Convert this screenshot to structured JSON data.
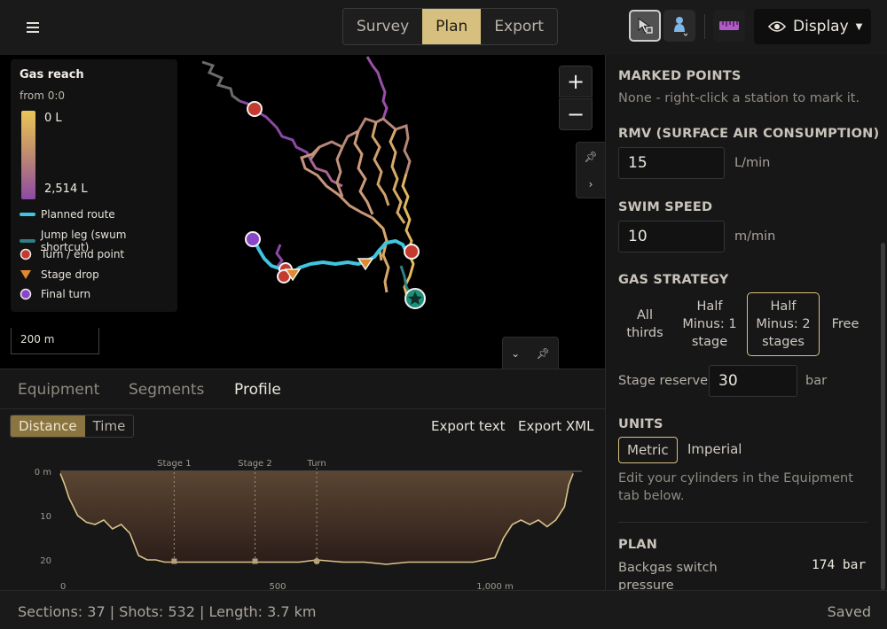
{
  "topbar": {
    "modes": [
      {
        "label": "Survey",
        "active": false
      },
      {
        "label": "Plan",
        "active": true
      },
      {
        "label": "Export",
        "active": false
      }
    ],
    "tools": [
      {
        "icon": "select-cursor-icon",
        "selected": true
      },
      {
        "icon": "diver-color-icon",
        "selected": false
      },
      {
        "icon": "ruler-icon",
        "selected": false
      }
    ],
    "display_label": "Display"
  },
  "map": {
    "legend": {
      "title": "Gas reach",
      "from": "from 0:0",
      "max_label": "0 L",
      "min_label": "2,514 L",
      "items": [
        {
          "label": "Planned route",
          "icon": "line-cyan",
          "color": "#40c4e0"
        },
        {
          "label": "Jump leg (swum shortcut)",
          "icon": "line-teal",
          "color": "#2e7f86"
        },
        {
          "label": "Turn / end point",
          "icon": "circle-red",
          "color": "#c53a2e"
        },
        {
          "label": "Stage drop",
          "icon": "triangle-orange",
          "color": "#e08a30"
        },
        {
          "label": "Final turn",
          "icon": "circle-purple",
          "color": "#8a46c8"
        }
      ]
    },
    "zoom_in": "+",
    "zoom_out": "−",
    "scale": "200 m"
  },
  "bottom": {
    "tabs": [
      {
        "label": "Equipment",
        "active": false
      },
      {
        "label": "Segments",
        "active": false
      },
      {
        "label": "Profile",
        "active": true
      }
    ],
    "axis_toggle": [
      {
        "label": "Distance",
        "active": true
      },
      {
        "label": "Time",
        "active": false
      }
    ],
    "export_text": "Export text",
    "export_xml": "Export XML"
  },
  "chart_data": {
    "type": "area",
    "title": "",
    "xlabel": "",
    "ylabel": "",
    "y_inverted": true,
    "xlim": [
      0,
      1200
    ],
    "ylim": [
      0,
      21
    ],
    "x_ticks": [
      "0",
      "500",
      "1,000 m"
    ],
    "y_ticks": [
      "0 m",
      "10",
      "20"
    ],
    "markers": [
      {
        "label": "Stage 1",
        "x": 262
      },
      {
        "label": "Stage 2",
        "x": 448
      },
      {
        "label": "Turn",
        "x": 590
      }
    ],
    "x": [
      0,
      10,
      20,
      40,
      60,
      80,
      100,
      120,
      140,
      160,
      180,
      200,
      220,
      240,
      262,
      300,
      350,
      400,
      448,
      500,
      550,
      590,
      650,
      700,
      750,
      800,
      850,
      900,
      950,
      1000,
      1020,
      1040,
      1060,
      1080,
      1100,
      1120,
      1140,
      1160,
      1170,
      1180
    ],
    "y": [
      0.5,
      3,
      6,
      10,
      11.5,
      12,
      11,
      13,
      12,
      14,
      19,
      20,
      20,
      20.5,
      20.5,
      20.5,
      20.5,
      20.5,
      20.5,
      20.5,
      20.5,
      20,
      20.5,
      20.5,
      21,
      20.5,
      20.5,
      20.5,
      20.5,
      19.5,
      15,
      12,
      11,
      12,
      11,
      12.5,
      11,
      8,
      3,
      0.5
    ]
  },
  "rpanel": {
    "marked_title": "MARKED POINTS",
    "marked_text": "None - right-click a station to mark it.",
    "rmv_title": "RMV (SURFACE AIR CONSUMPTION)",
    "rmv_value": "15",
    "rmv_unit": "L/min",
    "swim_title": "SWIM SPEED",
    "swim_value": "10",
    "swim_unit": "m/min",
    "gas_title": "GAS STRATEGY",
    "gas_options": [
      {
        "label": "All thirds",
        "active": false
      },
      {
        "label": "Half Minus: 1 stage",
        "active": false
      },
      {
        "label": "Half Minus: 2 stages",
        "active": true
      },
      {
        "label": "Free",
        "active": false
      }
    ],
    "stage_reserve_label": "Stage reserve",
    "stage_reserve_value": "30",
    "stage_reserve_unit": "bar",
    "units_title": "UNITS",
    "unit_options": [
      {
        "label": "Metric",
        "active": true
      },
      {
        "label": "Imperial",
        "active": false
      }
    ],
    "units_note": "Edit your cylinders in the Equipment tab below.",
    "plan_title": "PLAN",
    "backgas_label": "Backgas switch pressure",
    "backgas_value": "174 bar"
  },
  "status": {
    "summary": "Sections: 37 | Shots: 532 | Length: 3.7 km",
    "state": "Saved"
  }
}
